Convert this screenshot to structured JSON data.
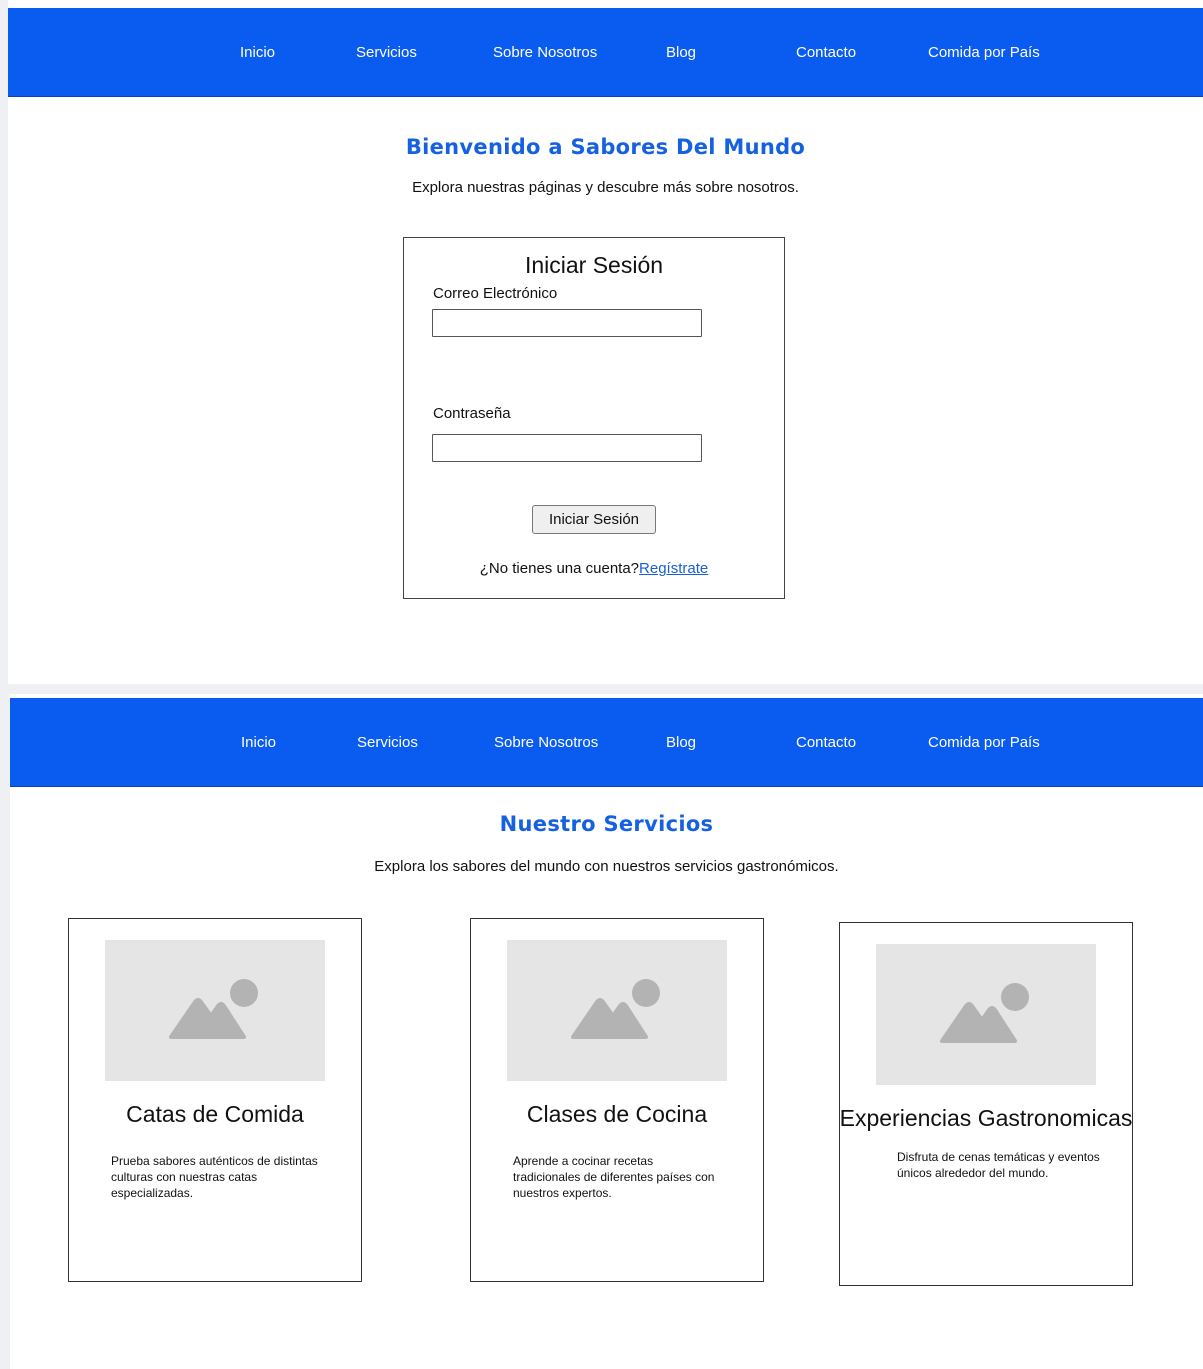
{
  "nav": {
    "items": [
      "Inicio",
      "Servicios",
      "Sobre Nosotros",
      "Blog",
      "Contacto",
      "Comida por País"
    ]
  },
  "home": {
    "title": "Bienvenido a Sabores Del Mundo",
    "subtitle": "Explora nuestras páginas y descubre más sobre nosotros.",
    "login": {
      "heading": "Iniciar Sesión",
      "email_label": "Correo Electrónico",
      "email_value": "",
      "password_label": "Contraseña",
      "password_value": "",
      "button_label": "Iniciar Sesión",
      "register_prompt": "¿No tienes una cuenta?",
      "register_link": "Regístrate"
    }
  },
  "services": {
    "title": "Nuestro Servicios",
    "subtitle": "Explora los sabores del mundo con nuestros servicios gastronómicos.",
    "cards": [
      {
        "icon": "image-placeholder-icon",
        "title": "Catas de Comida",
        "description": "Prueba sabores auténticos de distintas culturas con nuestras catas especializadas."
      },
      {
        "icon": "image-placeholder-icon",
        "title": "Clases de Cocina",
        "description": "Aprende a cocinar recetas tradicionales de diferentes países con nuestros expertos."
      },
      {
        "icon": "image-placeholder-icon",
        "title": "Experiencias Gastronomicas",
        "description": "Disfruta de cenas temáticas y eventos únicos alrededor del mundo."
      }
    ]
  },
  "colors": {
    "navbar": "#0a5cf0",
    "heading": "#1561e0",
    "link": "#1a5fd6",
    "placeholder_bg": "#e5e5e5",
    "placeholder_shape": "#b3b3b3"
  }
}
